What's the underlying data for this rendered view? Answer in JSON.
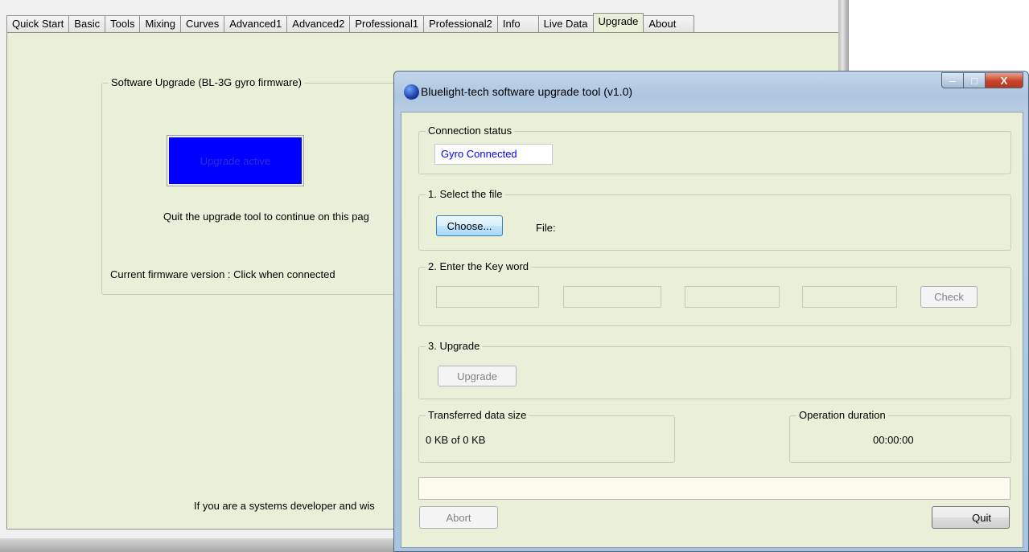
{
  "app": {
    "tabs": [
      "Quick Start",
      "Basic",
      "Tools",
      "Mixing",
      "Curves",
      "Advanced1",
      "Advanced2",
      "Professional1",
      "Professional2",
      "Info",
      "Live Data",
      "Upgrade",
      "About"
    ],
    "active_tab": "Upgrade",
    "group_title": "Software Upgrade (BL-3G gyro firmware)",
    "upgrade_active_label": "Upgrade active",
    "quit_msg": "Quit the upgrade tool to continue on this pag",
    "firmware_version": "Current firmware version : Click when connected",
    "developer_msg": "If you are a systems developer and wis"
  },
  "dialog": {
    "title": "Bluelight-tech software upgrade tool (v1.0)",
    "window_buttons": {
      "minimize": "–",
      "maximize": "□",
      "close": "X"
    },
    "connection": {
      "title": "Connection status",
      "status": "Gyro Connected",
      "status_color": "#0000ff"
    },
    "select_file": {
      "title": "1. Select the file",
      "choose_label": "Choose...",
      "file_label": "File:"
    },
    "key_word": {
      "title": "2. Enter the Key word",
      "check_label": "Check"
    },
    "upgrade": {
      "title": "3. Upgrade",
      "upgrade_label": "Upgrade"
    },
    "transferred": {
      "title": "Transferred data size",
      "value": "0 KB of 0 KB"
    },
    "duration": {
      "title": "Operation duration",
      "value": "00:00:00"
    },
    "abort_label": "Abort",
    "quit_label": "Quit"
  }
}
